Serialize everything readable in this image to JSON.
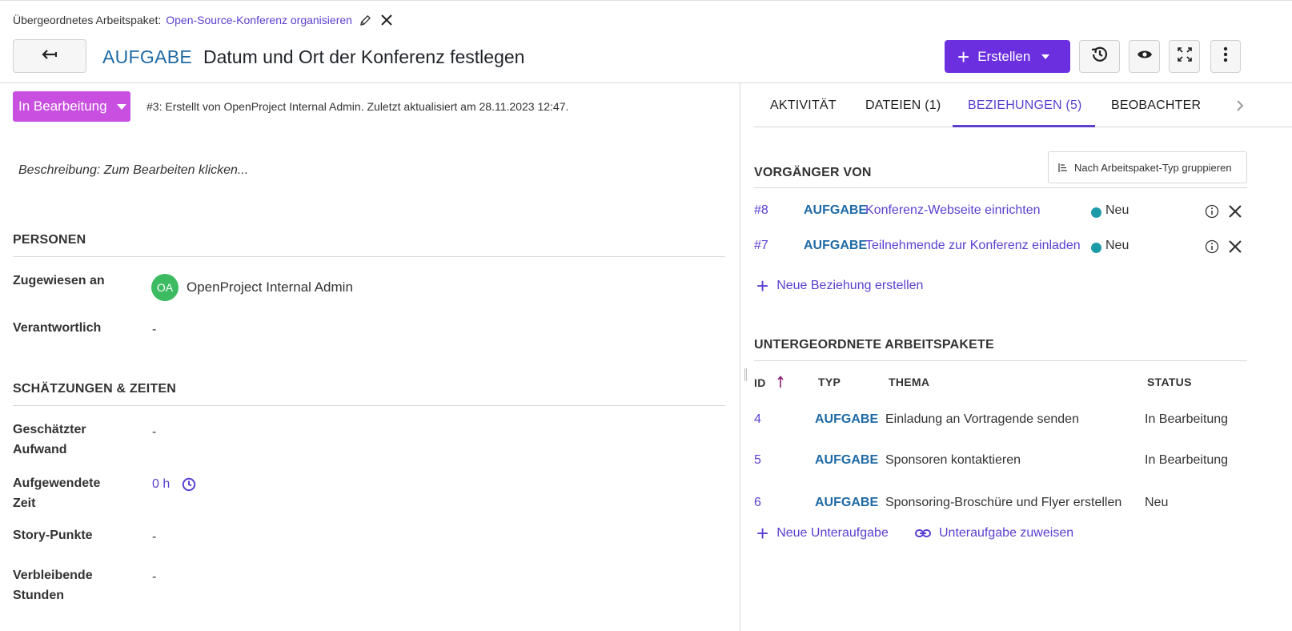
{
  "header": {
    "parent_label": "Übergeordnetes Arbeitspaket:",
    "parent_link": "Open-Source-Konferenz organisieren",
    "type": "AUFGABE",
    "subject": "Datum und Ort der Konferenz festlegen",
    "create_label": "Erstellen"
  },
  "details": {
    "status": "In Bearbeitung",
    "meta": "#3: Erstellt von OpenProject Internal Admin. Zuletzt aktualisiert am 28.11.2023 12:47.",
    "description_placeholder": "Beschreibung: Zum Bearbeiten klicken...",
    "people_section": "PERSONEN",
    "assigned_label": "Zugewiesen an",
    "assignee_initials": "OA",
    "assignee_name": "OpenProject Internal Admin",
    "responsible_label": "Verantwortlich",
    "responsible_value": "-",
    "estimates_section": "SCHÄTZUNGEN & ZEITEN",
    "estimated_label_1": "Geschätzter",
    "estimated_label_2": "Aufwand",
    "estimated_value": "-",
    "spent_label_1": "Aufgewendete",
    "spent_label_2": "Zeit",
    "spent_value": "0 h",
    "story_points_label": "Story-Punkte",
    "story_points_value": "-",
    "remaining_label_1": "Verbleibende",
    "remaining_label_2": "Stunden",
    "remaining_value": "-"
  },
  "tabs": [
    "AKTIVITÄT",
    "DATEIEN (1)",
    "BEZIEHUNGEN (5)",
    "BEOBACHTER"
  ],
  "relations": {
    "group_button": "Nach Arbeitspaket-Typ gruppieren",
    "predecessor_title": "VORGÄNGER VON",
    "rows": [
      {
        "id": "#8",
        "type": "AUFGABE",
        "subject": "Konferenz-Webseite einrichten",
        "status": "Neu"
      },
      {
        "id": "#7",
        "type": "AUFGABE",
        "subject": "Teilnehmende zur Konferenz einladen",
        "status": "Neu"
      }
    ],
    "new_relation": "Neue Beziehung erstellen"
  },
  "children": {
    "title": "UNTERGEORDNETE ARBEITSPAKETE",
    "columns": [
      "ID",
      "TYP",
      "THEMA",
      "STATUS"
    ],
    "rows": [
      {
        "id": "4",
        "type": "AUFGABE",
        "subject": "Einladung an Vortragende senden",
        "status": "In Bearbeitung"
      },
      {
        "id": "5",
        "type": "AUFGABE",
        "subject": "Sponsoren kontaktieren",
        "status": "In Bearbeitung"
      },
      {
        "id": "6",
        "type": "AUFGABE",
        "subject": "Sponsoring-Broschüre und Flyer erstellen",
        "status": "Neu"
      }
    ],
    "new_child": "Neue Unteraufgabe",
    "assign_child": "Unteraufgabe zuweisen"
  },
  "colors": {
    "accent": "#5b3fd1",
    "primary_button": "#6b2fe0",
    "status_in_progress": "#c94fe0",
    "status_new": "#1d9aa8",
    "type_task": "#1f6aa5",
    "avatar": "#3dbb63"
  },
  "icons": [
    "pencil-icon",
    "close-icon",
    "back-arrow-icon",
    "plus-icon",
    "history-icon",
    "eye-icon",
    "fullscreen-icon",
    "more-vertical-icon",
    "chevron-right-icon",
    "group-list-icon",
    "info-icon",
    "remove-icon",
    "clock-icon",
    "link-icon",
    "sort-arrow-up-icon"
  ]
}
